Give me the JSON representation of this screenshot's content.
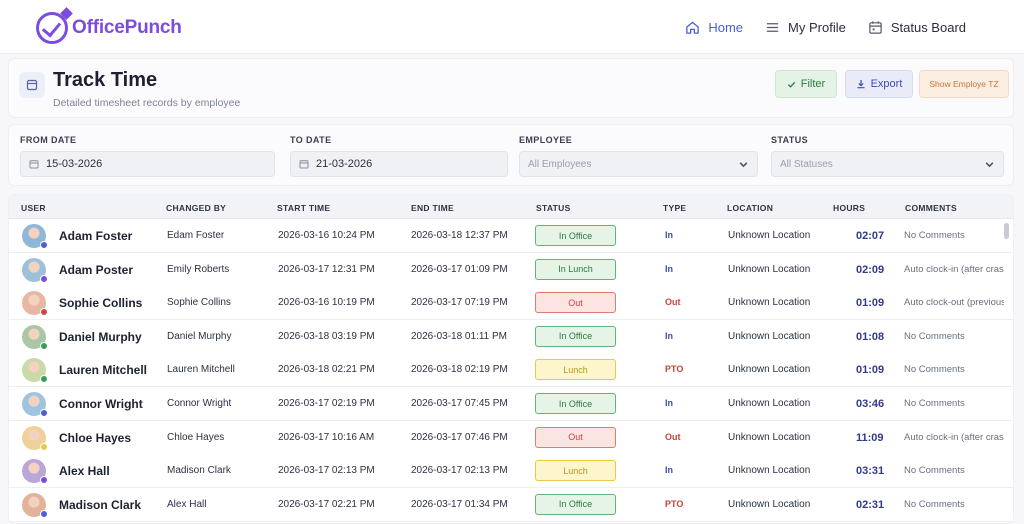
{
  "app": {
    "name": "OfficePunch"
  },
  "nav": {
    "home": "Home",
    "profile": "My Profile",
    "status_board": "Status Board"
  },
  "header": {
    "title": "Track Time",
    "subtitle": "Detailed timesheet records by employee",
    "filter_label": "Filter",
    "export_label": "Export",
    "tz_label": "Show Employe TZ"
  },
  "filters": {
    "from_label": "FROM DATE",
    "from_value": "15-03-2026",
    "to_label": "TO DATE",
    "to_value": "21-03-2026",
    "employee_label": "EMPLOYEE",
    "employee_value": "All Employees",
    "status_label": "STATUS",
    "status_value": "All Statuses"
  },
  "columns": [
    "USER",
    "CHANGED BY",
    "START TIME",
    "END TIME",
    "STATUS",
    "TYPE",
    "LOCATION",
    "HOURS",
    "COMMENTS"
  ],
  "colors": {
    "in_office_bg": "#e6f4e8",
    "in_office_border": "#63b474",
    "in_office_text": "#2c7a3e",
    "in_lunch_bg": "#e6f4e8",
    "in_lunch_border": "#63b474",
    "in_lunch_text": "#2c7a3e",
    "out_bg": "#fbe4e2",
    "out_border": "#e07b73",
    "out_text": "#c4443b",
    "lunch_bg": "#fdf5cc",
    "lunch_border": "#e8c94a",
    "lunch_text": "#b69516",
    "type_in": "#3b4cb0",
    "type_out": "#c4443b",
    "type_pto": "#c4443b"
  },
  "rows": [
    {
      "user": "Adam Foster",
      "changed_by": "Edam Foster",
      "start": "2026-03-16 10:24 PM",
      "end": "2026-03-18 12:37 PM",
      "status": "In Office",
      "status_kind": "in_office",
      "type": "In",
      "type_kind": "in",
      "location": "Unknown Location",
      "hours": "02:07",
      "comments": "No Comments",
      "avatar_color": "#8fb7d8",
      "dot_color": "#4a5fd8"
    },
    {
      "user": "Adam Poster",
      "changed_by": "Emily Roberts",
      "start": "2026-03-17 12:31 PM",
      "end": "2026-03-17 01:09 PM",
      "status": "In Lunch",
      "status_kind": "in_lunch",
      "type": "In",
      "type_kind": "in",
      "location": "Unknown Location",
      "hours": "02:09",
      "comments": "Auto clock-in (after crash)",
      "avatar_color": "#9ec1db",
      "dot_color": "#7c4ddc"
    },
    {
      "user": "Sophie Collins",
      "changed_by": "Sophie Collins",
      "start": "2026-03-16 10:19 PM",
      "end": "2026-03-17 07:19 PM",
      "status": "Out",
      "status_kind": "out",
      "type": "Out",
      "type_kind": "out",
      "location": "Unknown Location",
      "hours": "01:09",
      "comments": "Auto clock-out (previous-",
      "avatar_color": "#e8b7a4",
      "dot_color": "#d0463c"
    },
    {
      "user": "Daniel Murphy",
      "changed_by": "Daniel Murphy",
      "start": "2026-03-18 03:19 PM",
      "end": "2026-03-18 01:11 PM",
      "status": "In Office",
      "status_kind": "in_office",
      "type": "In",
      "type_kind": "in",
      "location": "Unknown Location",
      "hours": "01:08",
      "comments": "No Comments",
      "avatar_color": "#a9c7a6",
      "dot_color": "#3f9a55"
    },
    {
      "user": "Lauren Mitchell",
      "changed_by": "Lauren Mitchell",
      "start": "2026-03-18 02:21 PM",
      "end": "2026-03-18 02:19 PM",
      "status": "Lunch",
      "status_kind": "lunch",
      "type": "PTO",
      "type_kind": "pto",
      "location": "Unknown Location",
      "hours": "01:09",
      "comments": "No Comments",
      "avatar_color": "#c9d9a7",
      "dot_color": "#3f9a55"
    },
    {
      "user": "Connor Wright",
      "changed_by": "Connor Wright",
      "start": "2026-03-17 02:19 PM",
      "end": "2026-03-17 07:45 PM",
      "status": "In Office",
      "status_kind": "in_office",
      "type": "In",
      "type_kind": "in",
      "location": "Unknown Location",
      "hours": "03:46",
      "comments": "No Comments",
      "avatar_color": "#9fc4e0",
      "dot_color": "#4a5fd8"
    },
    {
      "user": "Chloe Hayes",
      "changed_by": "Chloe Hayes",
      "start": "2026-03-17 10:16 AM",
      "end": "2026-03-17 07:46 PM",
      "status": "Out",
      "status_kind": "out",
      "type": "Out",
      "type_kind": "out",
      "location": "Unknown Location",
      "hours": "11:09",
      "comments": "Auto clock-in (after crash)",
      "avatar_color": "#f0d19a",
      "dot_color": "#e8c94a"
    },
    {
      "user": "Alex Hall",
      "changed_by": "Madison Clark",
      "start": "2026-03-17 02:13 PM",
      "end": "2026-03-17 02:13 PM",
      "status": "Lunch",
      "status_kind": "lunch",
      "type": "In",
      "type_kind": "in",
      "location": "Unknown Location",
      "hours": "03:31",
      "comments": "No Comments",
      "avatar_color": "#b9a7d8",
      "dot_color": "#7c4ddc"
    },
    {
      "user": "Madison Clark",
      "changed_by": "Alex Hall",
      "start": "2026-03-17 02:21 PM",
      "end": "2026-03-17 01:34 PM",
      "status": "In Office",
      "status_kind": "in_office",
      "type": "PTO",
      "type_kind": "pto",
      "location": "Unknown Location",
      "hours": "02:31",
      "comments": "No Comments",
      "avatar_color": "#e2b29a",
      "dot_color": "#4a5fd8"
    }
  ]
}
